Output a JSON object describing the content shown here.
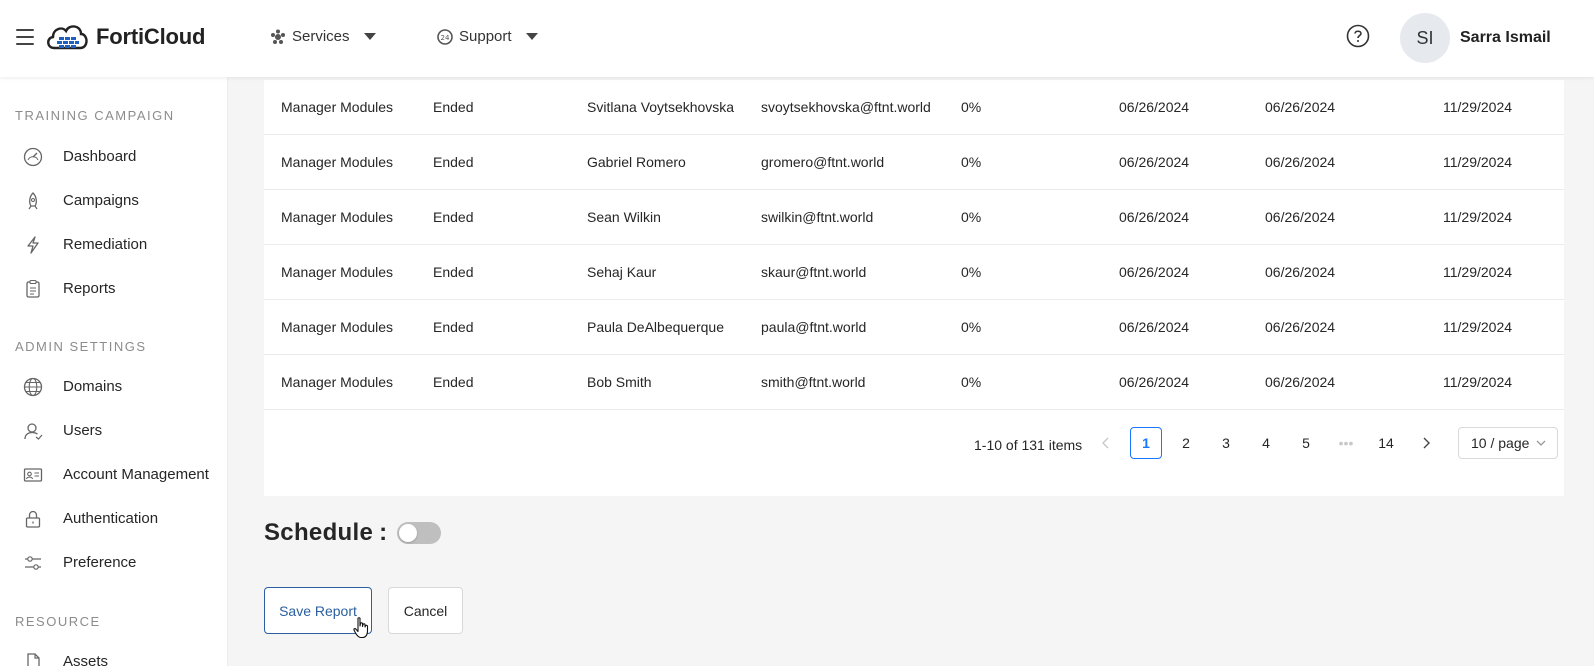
{
  "header": {
    "brand": "FortiCloud",
    "nav": [
      {
        "label": "Services",
        "icon": "services-icon"
      },
      {
        "label": "Support",
        "icon": "support-icon"
      }
    ],
    "help_icon": "help-circle-icon",
    "user": {
      "initials": "SI",
      "name": "Sarra Ismail"
    }
  },
  "sidebar": {
    "sections": [
      {
        "title": "TRAINING CAMPAIGN",
        "items": [
          {
            "label": "Dashboard",
            "icon": "gauge-icon"
          },
          {
            "label": "Campaigns",
            "icon": "rocket-icon"
          },
          {
            "label": "Remediation",
            "icon": "lightning-icon"
          },
          {
            "label": "Reports",
            "icon": "clipboard-icon"
          }
        ]
      },
      {
        "title": "ADMIN SETTINGS",
        "items": [
          {
            "label": "Domains",
            "icon": "globe-icon"
          },
          {
            "label": "Users",
            "icon": "user-icon"
          },
          {
            "label": "Account Management",
            "icon": "id-card-icon"
          },
          {
            "label": "Authentication",
            "icon": "lock-icon"
          },
          {
            "label": "Preference",
            "icon": "sliders-icon"
          }
        ]
      },
      {
        "title": "RESOURCE",
        "items": [
          {
            "label": "Assets",
            "icon": "file-icon"
          }
        ]
      }
    ]
  },
  "table": {
    "rows": [
      [
        "Manager Modules",
        "Ended",
        "Svitlana Voytsekhovska",
        "svoytsekhovska@ftnt.world",
        "0%",
        "06/26/2024",
        "06/26/2024",
        "11/29/2024"
      ],
      [
        "Manager Modules",
        "Ended",
        "Gabriel Romero",
        "gromero@ftnt.world",
        "0%",
        "06/26/2024",
        "06/26/2024",
        "11/29/2024"
      ],
      [
        "Manager Modules",
        "Ended",
        "Sean Wilkin",
        "swilkin@ftnt.world",
        "0%",
        "06/26/2024",
        "06/26/2024",
        "11/29/2024"
      ],
      [
        "Manager Modules",
        "Ended",
        "Sehaj Kaur",
        "skaur@ftnt.world",
        "0%",
        "06/26/2024",
        "06/26/2024",
        "11/29/2024"
      ],
      [
        "Manager Modules",
        "Ended",
        "Paula DeAlbequerque",
        "paula@ftnt.world",
        "0%",
        "06/26/2024",
        "06/26/2024",
        "11/29/2024"
      ],
      [
        "Manager Modules",
        "Ended",
        "Bob Smith",
        "smith@ftnt.world",
        "0%",
        "06/26/2024",
        "06/26/2024",
        "11/29/2024"
      ]
    ]
  },
  "pagination": {
    "total_text": "1-10 of 131 items",
    "pages": [
      "1",
      "2",
      "3",
      "4",
      "5"
    ],
    "ellipsis": "•••",
    "last_page": "14",
    "current": "1",
    "page_size": "10 / page"
  },
  "schedule": {
    "label": "Schedule",
    "colon": ":",
    "enabled": false
  },
  "actions": {
    "save_label": "Save Report",
    "cancel_label": "Cancel"
  },
  "colors": {
    "primary": "#1677ff",
    "save_border": "#2b5fa0",
    "toggle_off": "#bfbfbf"
  }
}
